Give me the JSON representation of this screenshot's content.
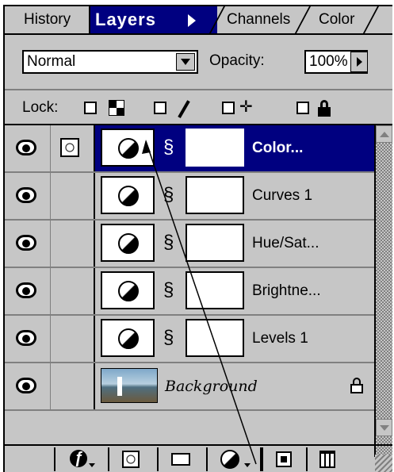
{
  "tabs": {
    "history": "History",
    "layers": "Layers",
    "channels": "Channels",
    "color": "Color"
  },
  "blend_mode": {
    "selected": "Normal",
    "opacity_label": "Opacity:",
    "opacity_value": "100%"
  },
  "lock": {
    "label": "Lock:"
  },
  "layers": [
    {
      "name": "Color...",
      "type": "adjustment",
      "selected": true
    },
    {
      "name": "Curves 1",
      "type": "adjustment",
      "selected": false
    },
    {
      "name": "Hue/Sat...",
      "type": "adjustment",
      "selected": false
    },
    {
      "name": "Brightne...",
      "type": "adjustment",
      "selected": false
    },
    {
      "name": "Levels 1",
      "type": "adjustment",
      "selected": false
    },
    {
      "name": "Background",
      "type": "image",
      "selected": false,
      "locked": true
    }
  ],
  "colors": {
    "selection": "#000080",
    "panel_bg": "#c6c6c6"
  },
  "toolbar": {
    "icons": [
      "layer-style-icon",
      "add-mask-icon",
      "new-set-icon",
      "adjustment-layer-icon",
      "new-layer-icon",
      "trash-icon"
    ]
  }
}
